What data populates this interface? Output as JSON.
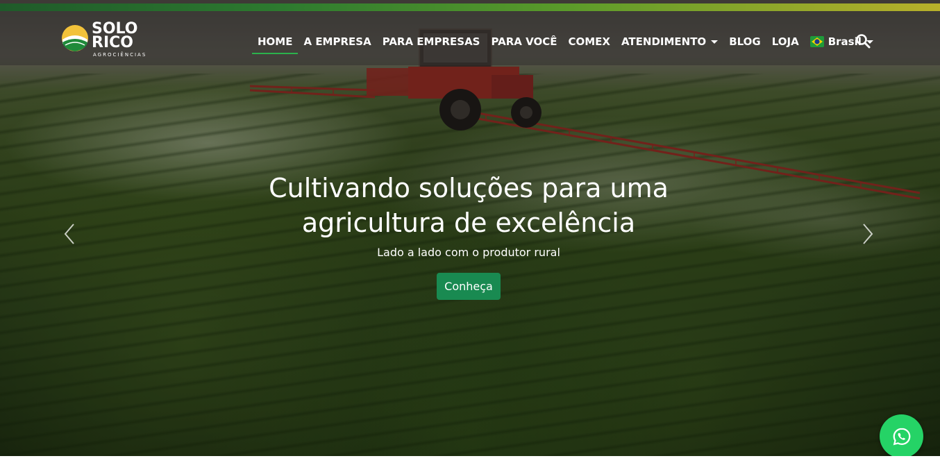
{
  "brand": {
    "name_line1": "SOLO",
    "name_line2": "RICO",
    "tagline": "AGROCIÊNCIAS"
  },
  "nav": {
    "items": [
      {
        "label": "HOME",
        "active": true
      },
      {
        "label": "A EMPRESA"
      },
      {
        "label": "PARA EMPRESAS"
      },
      {
        "label": "PARA VOCÊ"
      },
      {
        "label": "COMEX"
      },
      {
        "label": "ATENDIMENTO",
        "dropdown": true
      },
      {
        "label": "BLOG"
      },
      {
        "label": "LOJA"
      }
    ],
    "language": {
      "label": "Brasil",
      "icon": "brazil-flag-icon"
    },
    "search_icon": "search-icon"
  },
  "hero": {
    "title_line1": "Cultivando soluções para uma",
    "title_line2": "agricultura de excelência",
    "subtitle": "Lado a lado com o produtor rural",
    "cta_label": "Conheça"
  },
  "colors": {
    "accent_green": "#2bb24c",
    "cta_green": "#198a51",
    "whatsapp_green": "#25d366"
  },
  "icons": {
    "prev": "chevron-left-icon",
    "next": "chevron-right-icon",
    "whatsapp": "whatsapp-icon"
  }
}
